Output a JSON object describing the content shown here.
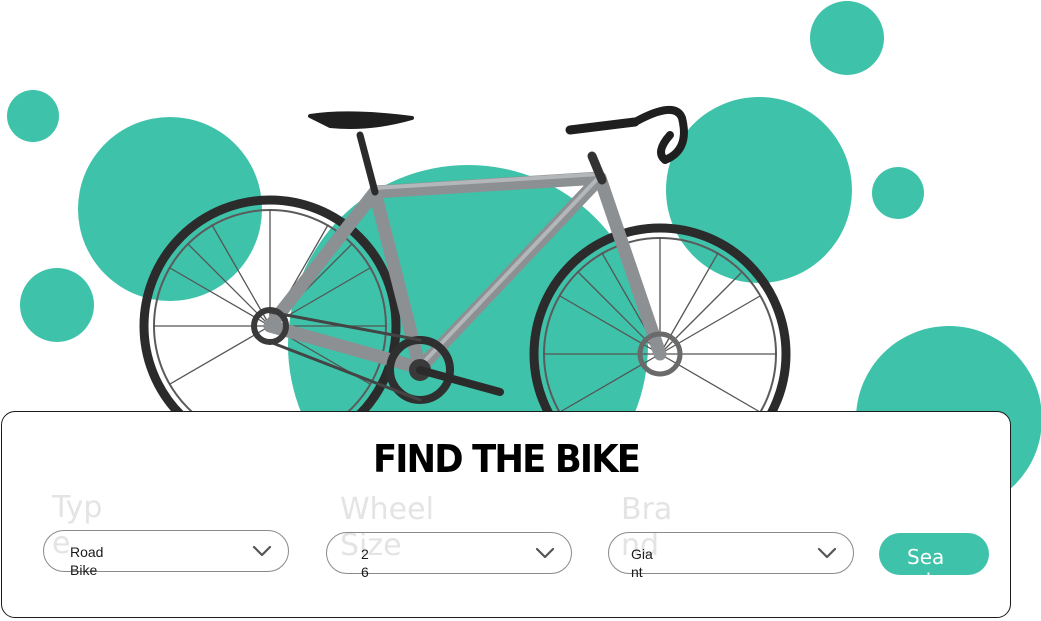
{
  "colors": {
    "accent": "#3ec2a9",
    "border": "#1b1b1b",
    "label_faded": "#e4e4e4"
  },
  "hero": {
    "image": "road-bike-photo"
  },
  "search_panel": {
    "title": "FIND THE BIKE",
    "fields": [
      {
        "label": "Type",
        "value": "Road Bike",
        "icon": "chevron-down-icon"
      },
      {
        "label": "Wheel Size",
        "value": "26",
        "icon": "chevron-down-icon"
      },
      {
        "label": "Brand",
        "value": "Giant",
        "icon": "chevron-down-icon"
      }
    ],
    "search_button": "Search"
  }
}
